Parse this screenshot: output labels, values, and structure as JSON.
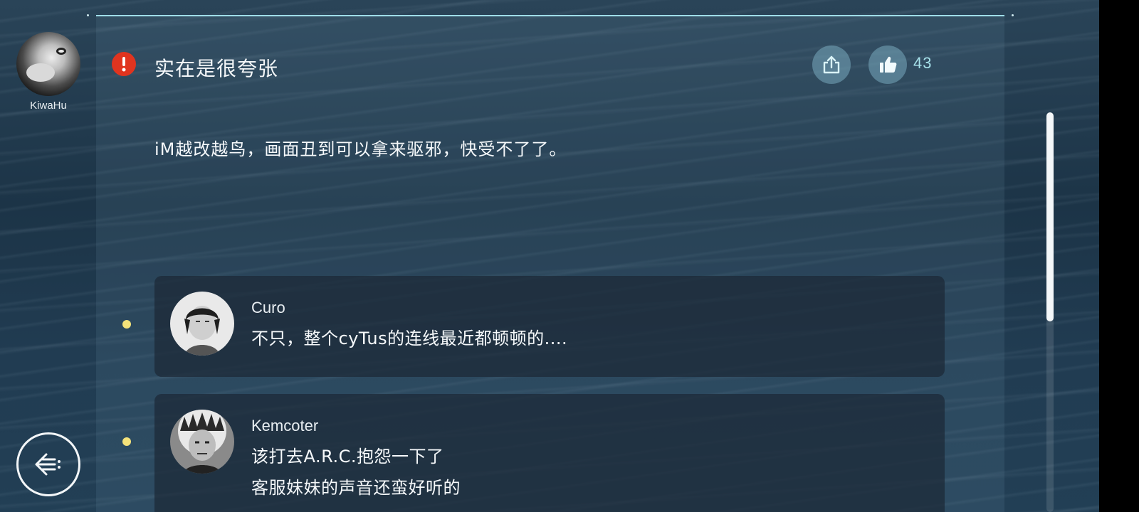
{
  "user": {
    "name": "KiwaHu"
  },
  "post": {
    "title": "实在是很夸张",
    "body": "iM越改越鸟，画面丑到可以拿来驱邪，快受不了了。",
    "like_count": "43"
  },
  "replies": [
    {
      "name": "Curo",
      "lines": [
        "不只，整个cyTus的连线最近都顿顿的...."
      ]
    },
    {
      "name": "Kemcoter",
      "lines": [
        "该打去A.R.C.抱怨一下了",
        "客服妹妹的声音还蛮好听的"
      ]
    }
  ],
  "icons": {
    "alert": "exclamation-circle-icon",
    "share": "share-icon",
    "like": "thumbs-up-icon",
    "back": "back-arrow-icon"
  },
  "colors": {
    "alert": "#e0341f",
    "accent": "#a6e1ea",
    "reply_dot": "#f4e27a"
  }
}
